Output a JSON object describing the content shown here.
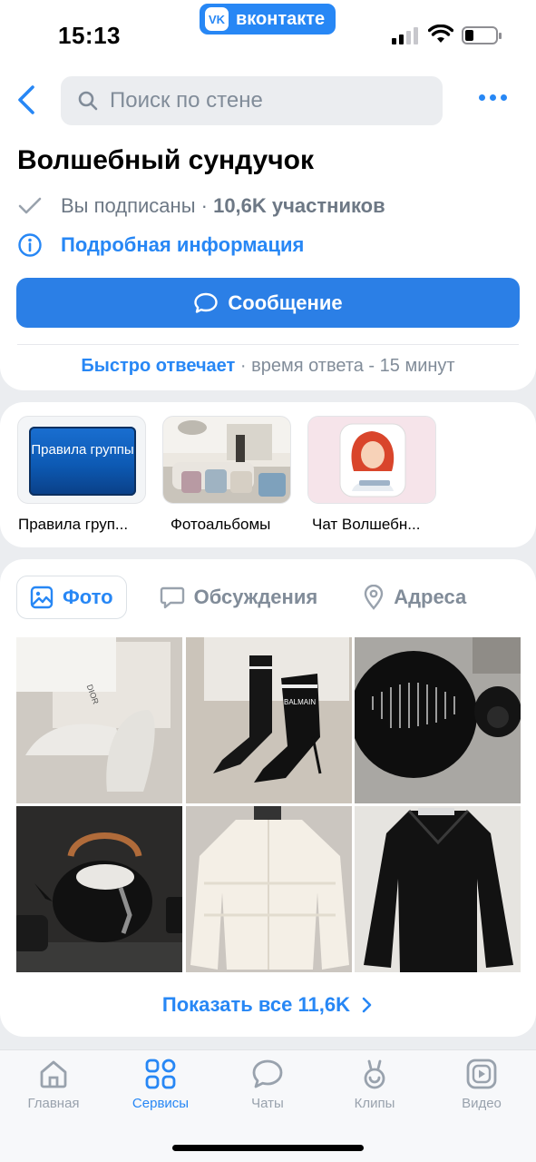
{
  "status_bar": {
    "time": "15:13",
    "badge": "вконтакте",
    "badge_logo": "VK"
  },
  "header": {
    "search_placeholder": "Поиск по стене"
  },
  "group": {
    "title": "Волшебный сундучок",
    "subscribed": "Вы подписаны",
    "separator": "·",
    "members": "10,6K участников",
    "info_link": "Подробная информация",
    "message_button": "Сообщение",
    "reply_fast": "Быстро отвечает",
    "reply_time": " · время ответа - 15 минут"
  },
  "links": [
    {
      "label": "Правила груп...",
      "tile_text": "Правила группы"
    },
    {
      "label": "Фотоальбомы"
    },
    {
      "label": "Чат Волшебн..."
    }
  ],
  "media": {
    "tabs": [
      {
        "label": "Фото",
        "active": true,
        "icon": "image-icon"
      },
      {
        "label": "Обсуждения",
        "active": false,
        "icon": "chat-bubble-icon"
      },
      {
        "label": "Адреса",
        "active": false,
        "icon": "location-pin-icon"
      }
    ],
    "photo_texts": {
      "dior": "DIOR",
      "balmain": "BALMAIN"
    },
    "show_all": "Показать все 11,6K"
  },
  "tabbar": [
    {
      "label": "Главная",
      "icon": "home-icon",
      "active": false
    },
    {
      "label": "Сервисы",
      "icon": "services-icon",
      "active": true
    },
    {
      "label": "Чаты",
      "icon": "chats-icon",
      "active": false
    },
    {
      "label": "Клипы",
      "icon": "clips-icon",
      "active": false
    },
    {
      "label": "Видео",
      "icon": "video-icon",
      "active": false
    }
  ],
  "colors": {
    "accent": "#2787f5",
    "button": "#2b7fe6",
    "background": "#ebedf0",
    "secondary_text": "#818c99"
  }
}
